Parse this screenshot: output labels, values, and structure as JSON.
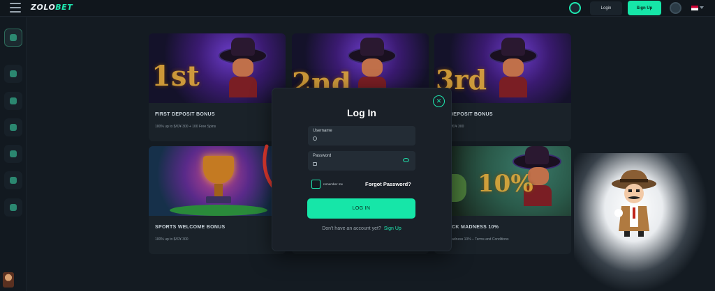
{
  "topbar": {
    "logo_main": "ZOLO",
    "logo_accent": "BET",
    "login_label": "Login",
    "signup_label": "Sign Up"
  },
  "cards": [
    {
      "title": "FIRST DEPOSIT BONUS",
      "desc": "100% up to $/€/¥ 300 + 100 Free Spins",
      "badge": "1st"
    },
    {
      "title": "",
      "desc": "",
      "badge": "2nd"
    },
    {
      "title": "RD DEPOSIT BONUS",
      "desc": "up to $/€/¥ 300",
      "badge": "3rd"
    },
    {
      "title": "SPORTS WELCOME BONUS",
      "desc": "100% up to $/€/¥ 300",
      "badge": ""
    },
    {
      "title": "",
      "desc": "",
      "badge": ""
    },
    {
      "title": "HBACK MADNESS 10%",
      "desc": "back Madness 10% – Terms and Conditions",
      "badge": "10%"
    }
  ],
  "modal": {
    "title": "Log In",
    "username_label": "Username",
    "username_value": "",
    "password_label": "Password",
    "password_value": "",
    "remember_label": "remember me",
    "forgot_label": "Forgot Password?",
    "login_button": "LOG IN",
    "no_account_text": "Don't have an account yet?",
    "signup_link": "Sign Up",
    "close_icon": "close-icon"
  },
  "colors": {
    "accent": "#16e6a8",
    "background": "#141b22",
    "arrow": "#e53a2f"
  }
}
